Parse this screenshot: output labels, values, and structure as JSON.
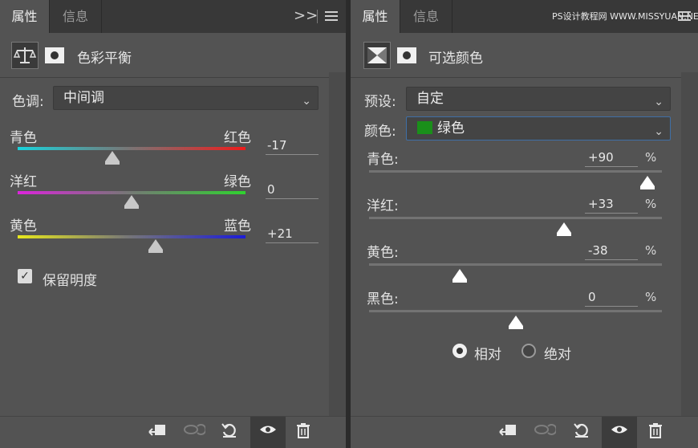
{
  "left": {
    "tabs": {
      "active": "属性",
      "inactive": "信息"
    },
    "header_icons": {
      "menu_toggle": "expand-icon",
      "panel_menu": "menu-icon"
    },
    "adjustment_title": "色彩平衡",
    "tone": {
      "label": "色调:",
      "value": "中间调"
    },
    "sliders": [
      {
        "left": "青色",
        "right": "红色",
        "value": "-17",
        "level": -17
      },
      {
        "left": "洋红",
        "right": "绿色",
        "value": "0",
        "level": 0
      },
      {
        "left": "黄色",
        "right": "蓝色",
        "value": "+21",
        "level": 21
      }
    ],
    "preserve": {
      "label": "保留明度",
      "checked": true
    }
  },
  "right": {
    "tabs": {
      "active": "属性",
      "inactive": "信息"
    },
    "adjustment_title": "可选颜色",
    "preset": {
      "label": "预设:",
      "value": "自定"
    },
    "colors": {
      "label": "颜色:",
      "value": "绿色",
      "swatch": "#1a8f1a"
    },
    "sliders": [
      {
        "label": "青色:",
        "value": "+90",
        "unit": "%",
        "level": 90
      },
      {
        "label": "洋红:",
        "value": "+33",
        "unit": "%",
        "level": 33
      },
      {
        "label": "黄色:",
        "value": "-38",
        "unit": "%",
        "level": -38
      },
      {
        "label": "黑色:",
        "value": "0",
        "unit": "%",
        "level": 0
      }
    ],
    "method": {
      "relative": "相对",
      "absolute": "绝对",
      "selected": "relative"
    },
    "watermark": "PS设计教程网 WWW.MISSYUAN.NET"
  },
  "footer_icons": [
    "clip-to-layer-icon",
    "view-previous-icon",
    "reset-icon",
    "visibility-eye-icon",
    "delete-trash-icon"
  ]
}
